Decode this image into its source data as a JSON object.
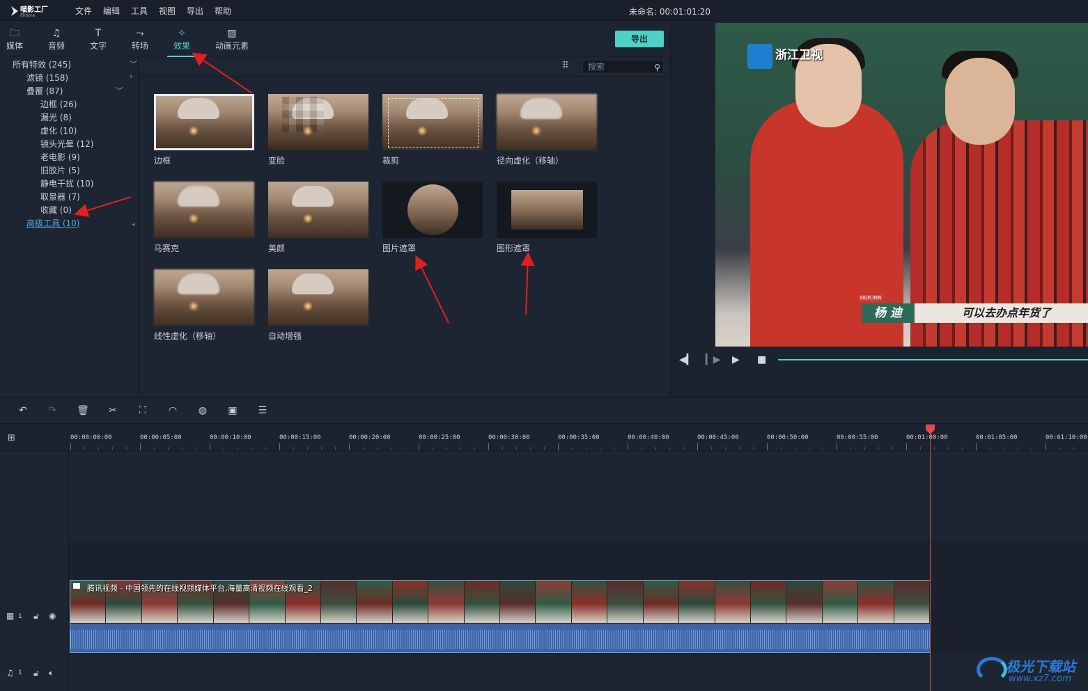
{
  "app": {
    "logo_name": "喵影工厂",
    "logo_sub": "filmora",
    "menu": [
      "文件",
      "编辑",
      "工具",
      "视图",
      "导出",
      "帮助"
    ],
    "project_title": "未命名: 00:01:01:20"
  },
  "tabs": [
    {
      "label": "媒体",
      "icon": "folder-icon",
      "glyph": "🗀"
    },
    {
      "label": "音频",
      "icon": "music-note-icon",
      "glyph": "♫"
    },
    {
      "label": "文字",
      "icon": "text-icon",
      "glyph": "T"
    },
    {
      "label": "转场",
      "icon": "transition-icon",
      "glyph": "⤳"
    },
    {
      "label": "效果",
      "icon": "effects-icon",
      "glyph": "✧",
      "active": true
    },
    {
      "label": "动画元素",
      "icon": "image-icon",
      "glyph": "▨"
    }
  ],
  "export_label": "导出",
  "categories": [
    {
      "label": "所有特效 (245)",
      "chevron": "﹀"
    },
    {
      "label": "滤镜 (158)",
      "chevron": "›"
    },
    {
      "label": "叠覆 (87)",
      "chevron": "﹀"
    },
    {
      "label": "边框 (26)"
    },
    {
      "label": "漏光 (8)"
    },
    {
      "label": "虚化 (10)"
    },
    {
      "label": "镜头光晕 (12)"
    },
    {
      "label": "老电影 (9)"
    },
    {
      "label": "旧胶片 (5)"
    },
    {
      "label": "静电干扰 (10)"
    },
    {
      "label": "取景器 (7)"
    },
    {
      "label": "收藏 (0)"
    },
    {
      "label": "高级工具 (10)",
      "link": true
    }
  ],
  "search": {
    "placeholder": "搜索"
  },
  "effects": [
    {
      "label": "边框",
      "style": "sel"
    },
    {
      "label": "变脸",
      "style": "pix"
    },
    {
      "label": "裁剪",
      "style": "crop"
    },
    {
      "label": "径向虚化（移轴）",
      "style": "blur"
    },
    {
      "label": "马赛克",
      "style": "blur"
    },
    {
      "label": "美颜",
      "style": "plain"
    },
    {
      "label": "图片遮罩",
      "style": "circle"
    },
    {
      "label": "图形遮罩",
      "style": "rect"
    },
    {
      "label": "线性虚化（移轴）",
      "style": "blur"
    },
    {
      "label": "自动增强",
      "style": "plain"
    }
  ],
  "preview": {
    "station": "浙江卫视",
    "name_caption": "杨 迪",
    "caption_text": "可以去办点年货了",
    "tag": "OUR INN",
    "progress": 1.0
  },
  "timeline": {
    "ticks": [
      "00:00:00:00",
      "00:00:05:00",
      "00:00:10:00",
      "00:00:15:00",
      "00:00:20:00",
      "00:00:25:00",
      "00:00:30:00",
      "00:00:35:00",
      "00:00:40:00",
      "00:00:45:00",
      "00:00:50:00",
      "00:00:55:00",
      "00:01:00:00",
      "00:01:05:00",
      "00:01:10:00"
    ],
    "clip_title": "腾讯视频 - 中国领先的在线视频媒体平台,海量高清视频在线观看_2",
    "video_track": "1",
    "audio_track": "1"
  },
  "watermark": {
    "line1": "极光下载站",
    "line2": "www.xz7.com"
  },
  "colors": {
    "accent": "#4fd1c5",
    "playhead": "#e04a4a",
    "link": "#4aa8d8",
    "arrow": "#e02020"
  }
}
